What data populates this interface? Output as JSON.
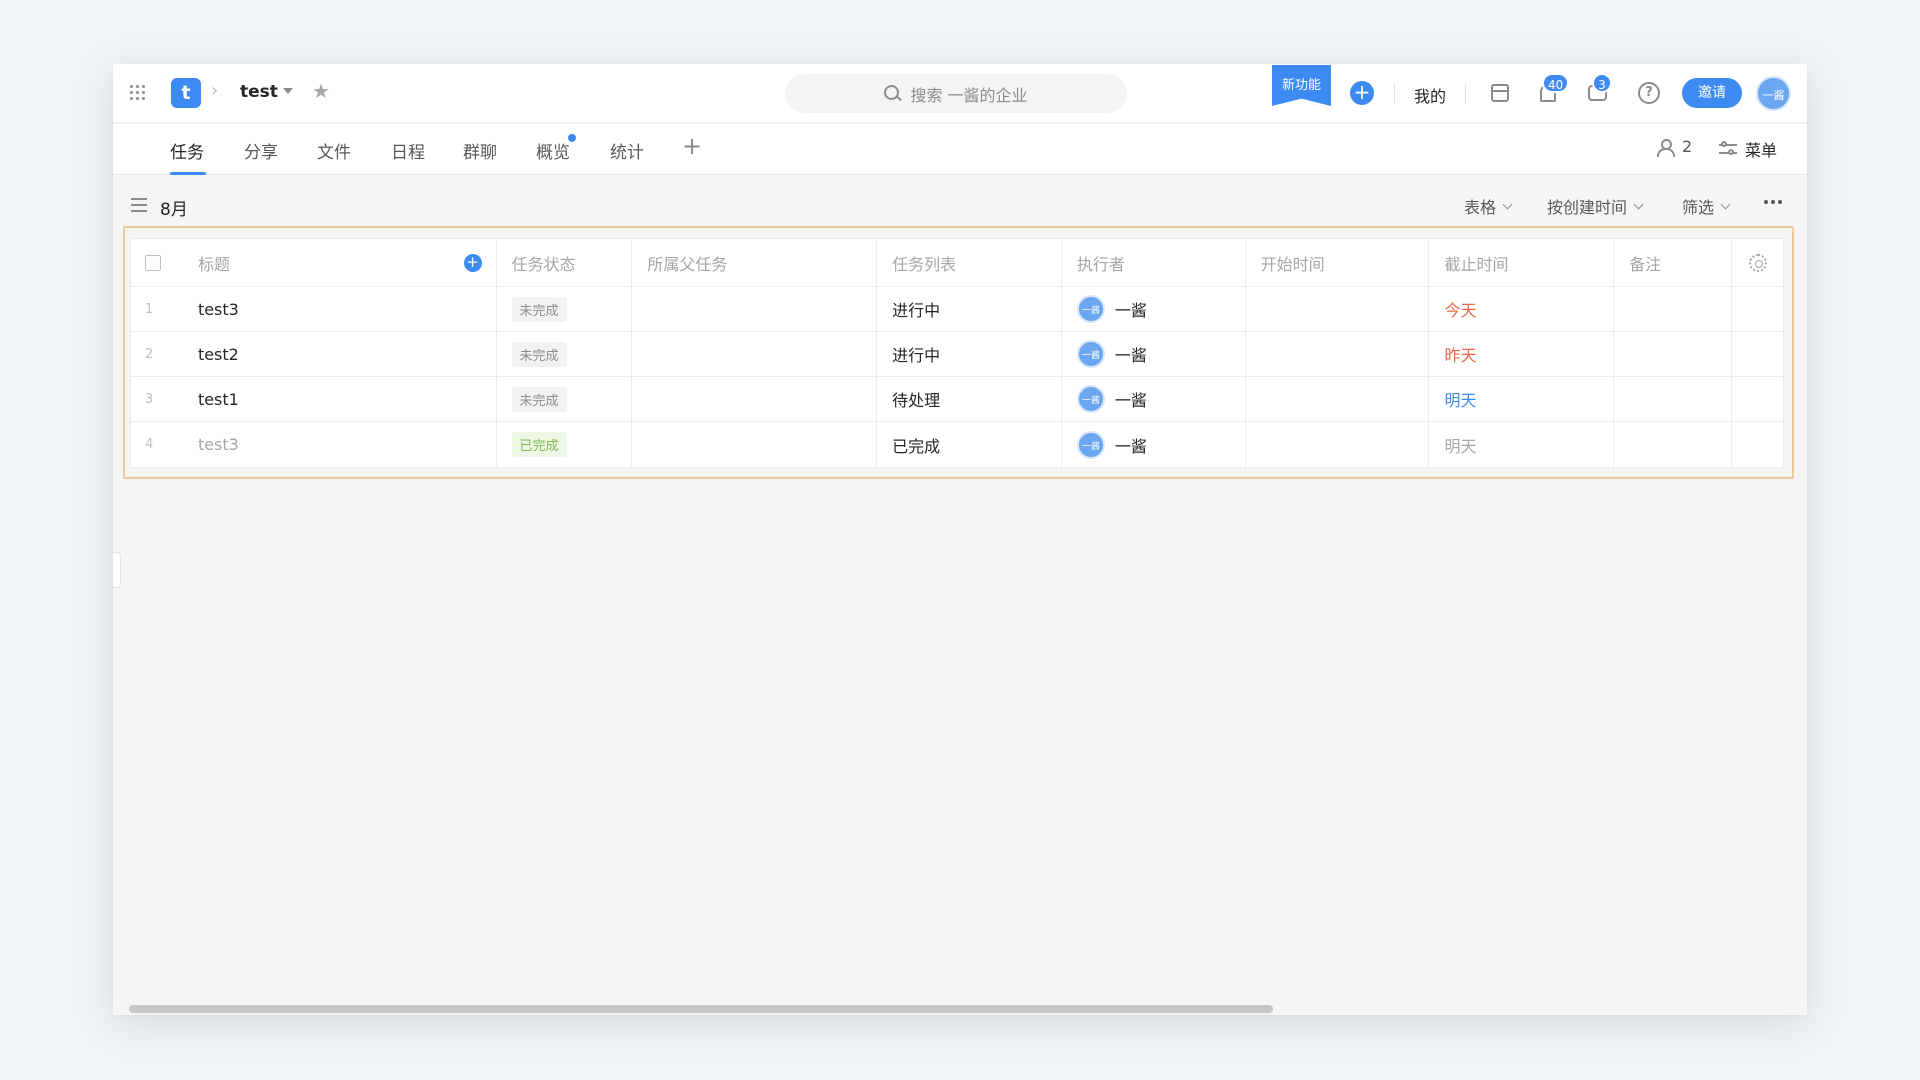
{
  "topbar": {
    "project_logo_letter": "t",
    "project_name": "test",
    "search_placeholder": "搜索 一酱的企业",
    "new_feature_label": "新功能",
    "mine_label": "我的",
    "notifications_count": "40",
    "messages_count": "3",
    "help_glyph": "?",
    "invite_label": "邀请",
    "user_avatar_text": "一酱"
  },
  "tabs": [
    {
      "label": "任务",
      "active": true
    },
    {
      "label": "分享"
    },
    {
      "label": "文件"
    },
    {
      "label": "日程"
    },
    {
      "label": "群聊"
    },
    {
      "label": "概览",
      "has_dot": true
    },
    {
      "label": "统计"
    }
  ],
  "tab_add_label": "+",
  "members_count": "2",
  "menu_label": "菜单",
  "toolbar": {
    "list_name": "8月",
    "view_label": "表格",
    "sort_label": "按创建时间",
    "filter_label": "筛选"
  },
  "table": {
    "columns": [
      "标题",
      "任务状态",
      "所属父任务",
      "任务列表",
      "执行者",
      "开始时间",
      "截止时间",
      "备注"
    ],
    "rows": [
      {
        "index": "1",
        "title": "test3",
        "status": "未完成",
        "parent": "",
        "list": "进行中",
        "assignee_avatar": "一酱",
        "assignee": "一酱",
        "start": "",
        "due": "今天",
        "note": "",
        "done": false
      },
      {
        "index": "2",
        "title": "test2",
        "status": "未完成",
        "parent": "",
        "list": "进行中",
        "assignee_avatar": "一酱",
        "assignee": "一酱",
        "start": "",
        "due": "昨天",
        "note": "",
        "done": false
      },
      {
        "index": "3",
        "title": "test1",
        "status": "未完成",
        "parent": "",
        "list": "待处理",
        "assignee_avatar": "一酱",
        "assignee": "一酱",
        "start": "",
        "due": "明天",
        "note": "",
        "done": false
      },
      {
        "index": "4",
        "title": "test3",
        "status": "已完成",
        "parent": "",
        "list": "已完成",
        "assignee_avatar": "一酱",
        "assignee": "一酱",
        "start": "",
        "due": "明天",
        "note": "",
        "done": true
      }
    ]
  },
  "colors": {
    "accent": "#3d8bf2",
    "due_today": "#e8694a",
    "due_yesterday": "#e8694a",
    "due_tomorrow": "#3d8bf2",
    "done_tag": "#7cbb4f",
    "highlight_border": "#f0c8a0"
  }
}
